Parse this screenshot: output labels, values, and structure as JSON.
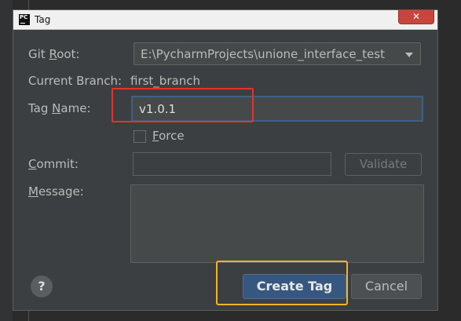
{
  "window": {
    "title": "Tag",
    "logo_text": "PC",
    "close_glyph": "✕"
  },
  "form": {
    "git_root": {
      "prefix": "Git ",
      "mnemonic": "R",
      "suffix": "oot:",
      "value": "E:\\PycharmProjects\\unione_interface_test"
    },
    "current_branch": {
      "label": "Current Branch:",
      "value": "first_branch"
    },
    "tag_name": {
      "prefix": "Tag ",
      "mnemonic": "N",
      "suffix": "ame:",
      "value": "v1.0.1"
    },
    "force": {
      "mnemonic": "F",
      "suffix": "orce",
      "checked": false
    },
    "commit": {
      "mnemonic": "C",
      "suffix": "ommit:",
      "value": ""
    },
    "validate_label": "Validate",
    "message": {
      "mnemonic": "M",
      "suffix": "essage:",
      "value": ""
    }
  },
  "footer": {
    "help_label": "?",
    "create_tag_label": "Create Tag",
    "cancel_label": "Cancel"
  },
  "colors": {
    "primary_button": "#365880",
    "annotation_red": "#e3342b",
    "annotation_yellow": "#f0b429"
  }
}
